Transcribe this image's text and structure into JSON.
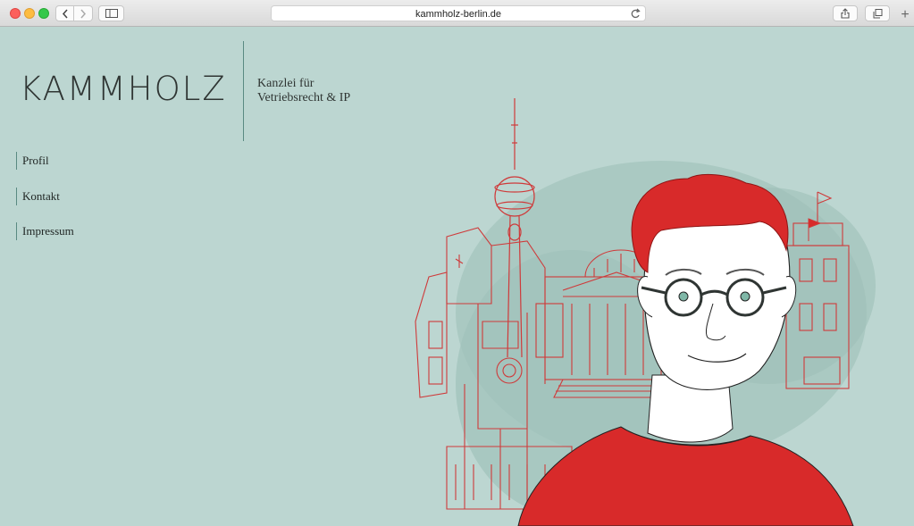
{
  "browser": {
    "url": "kammholz-berlin.de",
    "new_tab": "+"
  },
  "header": {
    "logo": "KAMMHOLZ",
    "tagline_line1": "Kanzlei für",
    "tagline_line2": "Vetriebsrecht & IP"
  },
  "nav": {
    "items": [
      {
        "label": "Profil"
      },
      {
        "label": "Kontakt"
      },
      {
        "label": "Impressum"
      }
    ]
  },
  "colors": {
    "background": "#bcd6d1",
    "accent_red": "#d82a2a",
    "divider": "#5a8a82",
    "text": "#2f3533"
  }
}
